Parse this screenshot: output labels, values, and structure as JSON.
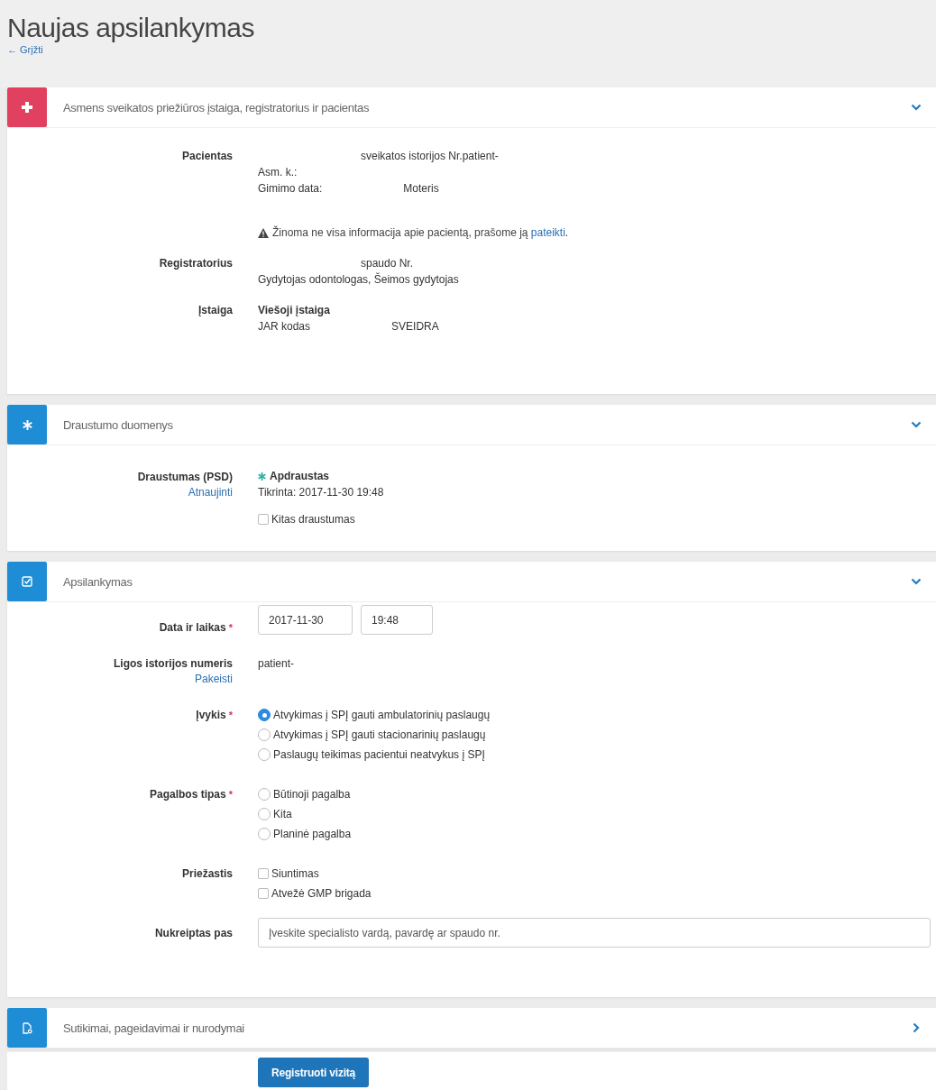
{
  "page": {
    "title": "Naujas apsilankymas",
    "back_link": "← Grįžti"
  },
  "panels": [
    {
      "color": "#e2405f",
      "title": "Asmens sveikatos priežiūros įstaiga, registratorius ir pacientas",
      "expanded": true,
      "rows": [
        {
          "label": "Pacientas",
          "items": [
            {
              "kind": "line",
              "parts": [
                "sveikatos istorijos Nr.patient-"
              ],
              "lead_gap": true
            },
            {
              "kind": "line",
              "parts": [
                "Asm. k.:"
              ]
            },
            {
              "kind": "line",
              "parts": [
                "Gimimo data:",
                "Moteris"
              ]
            },
            {
              "kind": "note",
              "text": "Žinoma ne visa informacija apie pacientą, prašome ją",
              "link": "pateikti",
              "end": "."
            }
          ]
        },
        {
          "label": "Registratorius",
          "items": [
            {
              "kind": "line",
              "parts": [
                "spaudo Nr."
              ],
              "lead_gap": true
            },
            {
              "kind": "line",
              "parts": [
                "Gydytojas odontologas, Šeimos gydytojas"
              ]
            }
          ]
        },
        {
          "label": "Įstaiga",
          "items": [
            {
              "kind": "line",
              "parts": [
                "Viešoji įstaiga"
              ],
              "bold": true
            },
            {
              "kind": "line",
              "parts": [
                "JAR kodas",
                "SVEIDRA"
              ]
            }
          ]
        }
      ]
    },
    {
      "color": "#1f8dd6",
      "title": "Draustumo duomenys",
      "expanded": true,
      "rows": [
        {
          "label": "Draustumas (PSD)",
          "link": "Atnaujinti",
          "items": [
            {
              "kind": "status",
              "text": "Apdraustas"
            },
            {
              "kind": "line",
              "parts": [
                "Tikrinta: 2017-11-30 19:48"
              ]
            },
            {
              "kind": "checkbox",
              "label": "Kitas draustumas",
              "checked": false
            }
          ]
        }
      ]
    },
    {
      "color": "#1f8dd6",
      "title": "Apsilankymas",
      "expanded": true,
      "rows": [
        {
          "label": "Data ir laikas",
          "required_mark": "*",
          "items": [
            {
              "kind": "datetime",
              "date": "2017-11-30",
              "time": "19:48"
            }
          ]
        },
        {
          "label": "Ligos istorijos numeris",
          "link": "Pakeisti",
          "items": [
            {
              "kind": "line",
              "parts": [
                "patient-"
              ]
            }
          ]
        },
        {
          "label": "Įvykis",
          "required_mark": "*",
          "items": [
            {
              "kind": "radio",
              "label": "Atvykimas į SPĮ gauti ambulatorinių paslaugų",
              "selected": true
            },
            {
              "kind": "radio",
              "label": "Atvykimas į SPĮ gauti stacionarinių paslaugų",
              "selected": false
            },
            {
              "kind": "radio",
              "label": "Paslaugų teikimas pacientui neatvykus į SPĮ",
              "selected": false
            }
          ]
        },
        {
          "label": "Pagalbos tipas",
          "required_mark": "*",
          "items": [
            {
              "kind": "radio",
              "label": "Būtinoji pagalba",
              "selected": false
            },
            {
              "kind": "radio",
              "label": "Kita",
              "selected": false
            },
            {
              "kind": "radio",
              "label": "Planinė pagalba",
              "selected": false
            }
          ]
        },
        {
          "label": "Priežastis",
          "items": [
            {
              "kind": "checkbox",
              "label": "Siuntimas",
              "checked": false
            },
            {
              "kind": "checkbox",
              "label": "Atvežė GMP brigada",
              "checked": false
            }
          ]
        },
        {
          "label": "Nukreiptas pas",
          "items": [
            {
              "kind": "input",
              "placeholder": "Įveskite specialisto vardą, pavardę ar spaudo nr."
            }
          ]
        }
      ]
    },
    {
      "color": "#1f8dd6",
      "title": "Sutikimai, pageidavimai ir nurodymai",
      "expanded": false
    }
  ],
  "submit_button": "Registruoti vizitą"
}
